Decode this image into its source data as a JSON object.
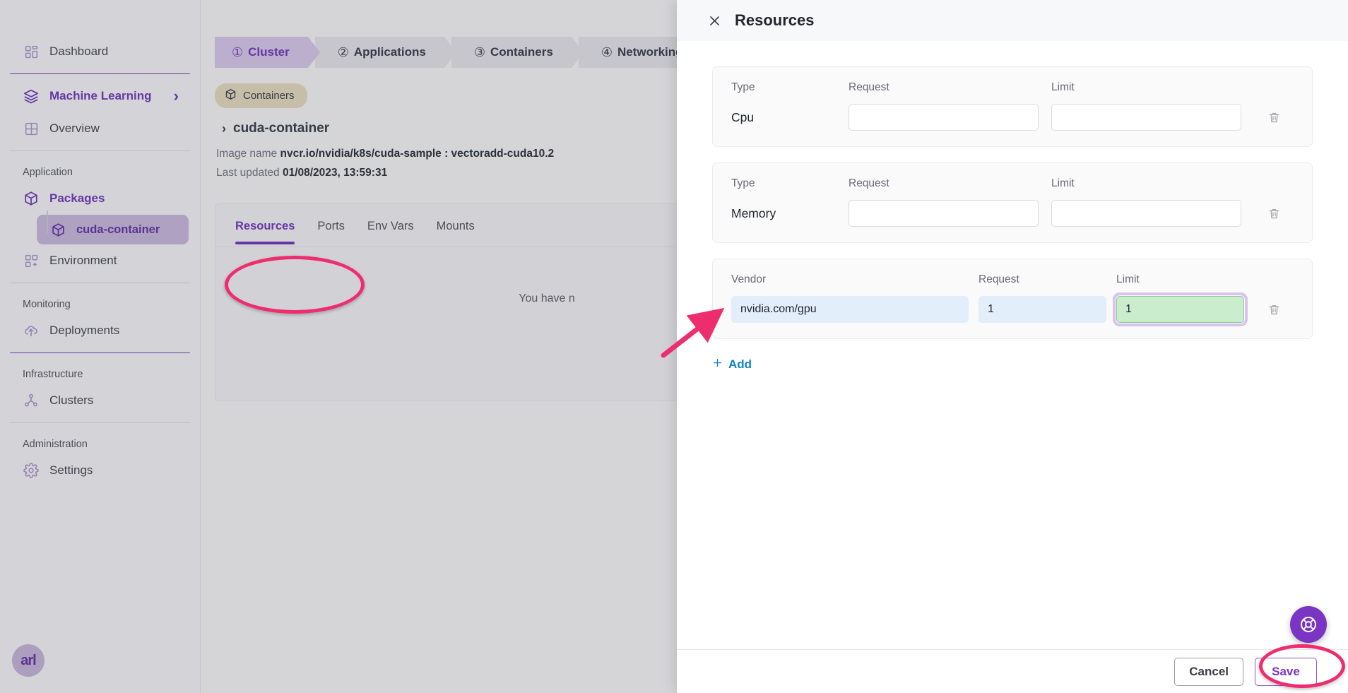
{
  "sidebar": {
    "items": [
      {
        "label": "Dashboard",
        "icon": "dashboard-icon"
      },
      {
        "label": "Machine Learning",
        "icon": "layers-icon",
        "chevron": "›"
      },
      {
        "label": "Overview",
        "icon": "grid-icon"
      }
    ],
    "sections": [
      {
        "title": "Application",
        "items": [
          {
            "label": "Packages",
            "icon": "package-icon"
          },
          {
            "label": "cuda-container",
            "icon": "package-icon"
          },
          {
            "label": "Environment",
            "icon": "env-icon"
          }
        ]
      },
      {
        "title": "Monitoring",
        "items": [
          {
            "label": "Deployments",
            "icon": "cloud-upload-icon"
          }
        ]
      },
      {
        "title": "Infrastructure",
        "items": [
          {
            "label": "Clusters",
            "icon": "cluster-icon"
          }
        ]
      },
      {
        "title": "Administration",
        "items": [
          {
            "label": "Settings",
            "icon": "gear-icon"
          }
        ]
      }
    ],
    "logo_text": "arl"
  },
  "wizard": {
    "steps": [
      {
        "num": "①",
        "label": "Cluster",
        "active": true
      },
      {
        "num": "②",
        "label": "Applications",
        "active": false
      },
      {
        "num": "③",
        "label": "Containers",
        "active": false
      },
      {
        "num": "④",
        "label": "Networking",
        "active": false
      }
    ]
  },
  "main": {
    "chip_label": "Containers",
    "breadcrumb_caret": "›",
    "breadcrumb_label": "cuda-container",
    "image_name_label": "Image name",
    "image_name_value": "nvcr.io/nvidia/k8s/cuda-sample : vectoradd-cuda10.2",
    "last_updated_label": "Last updated",
    "last_updated_value": "01/08/2023, 13:59:31",
    "tabs": [
      {
        "label": "Resources",
        "active": true
      },
      {
        "label": "Ports",
        "active": false
      },
      {
        "label": "Env Vars",
        "active": false
      },
      {
        "label": "Mounts",
        "active": false
      }
    ],
    "empty_text": "You have n"
  },
  "drawer": {
    "title": "Resources",
    "close_icon": "close-icon",
    "rows": [
      {
        "col1_label": "Type",
        "col1_value": "Cpu",
        "request_label": "Request",
        "request_value": "",
        "limit_label": "Limit",
        "limit_value": "",
        "delete_icon": "trash-icon"
      },
      {
        "col1_label": "Type",
        "col1_value": "Memory",
        "request_label": "Request",
        "request_value": "",
        "limit_label": "Limit",
        "limit_value": "",
        "delete_icon": "trash-icon"
      }
    ],
    "vendor_row": {
      "vendor_label": "Vendor",
      "vendor_value": "nvidia.com/gpu",
      "request_label": "Request",
      "request_value": "1",
      "limit_label": "Limit",
      "limit_value": "1",
      "delete_icon": "trash-icon"
    },
    "add_label": "Add",
    "add_icon": "plus-icon",
    "cancel_label": "Cancel",
    "save_label": "Save",
    "help_icon": "lifebuoy-icon"
  },
  "colors": {
    "accent_purple": "#6a2fb5",
    "annotation_pink": "#ee2d6e",
    "link_blue": "#0f84c4",
    "focus_green": "#c9edcd",
    "filled_blue": "#e3eefb",
    "chip_tan": "#e3d8bb"
  }
}
